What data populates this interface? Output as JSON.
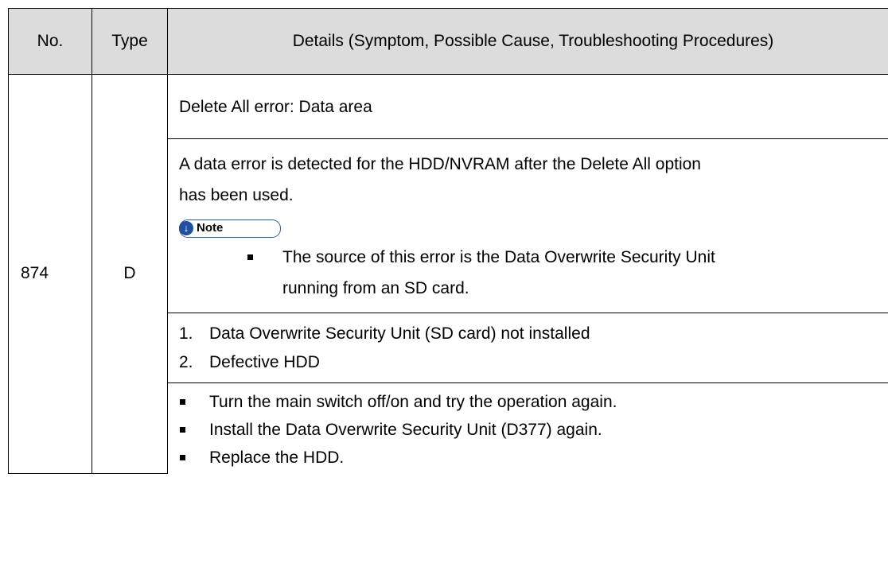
{
  "header": {
    "no": "No.",
    "type": "Type",
    "details": "Details (Symptom, Possible Cause, Troubleshooting Procedures)"
  },
  "row": {
    "no": "874",
    "type": "D",
    "title": "Delete All error: Data area",
    "symptom_line1": "A data error is detected for the HDD/NVRAM after the Delete All option",
    "symptom_line2": "has been used.",
    "note_label": "Note",
    "note_icon": "down-arrow-circle-icon",
    "note_line1": "The source of this error is the Data Overwrite Security Unit",
    "note_line2": "running from an SD card.",
    "causes": [
      {
        "num": "1.",
        "text": "Data Overwrite Security Unit (SD card) not installed"
      },
      {
        "num": "2.",
        "text": "Defective HDD"
      }
    ],
    "procedures": [
      "Turn the main switch off/on and try the operation again.",
      "Install the Data Overwrite Security Unit (D377) again.",
      "Replace the HDD."
    ]
  }
}
